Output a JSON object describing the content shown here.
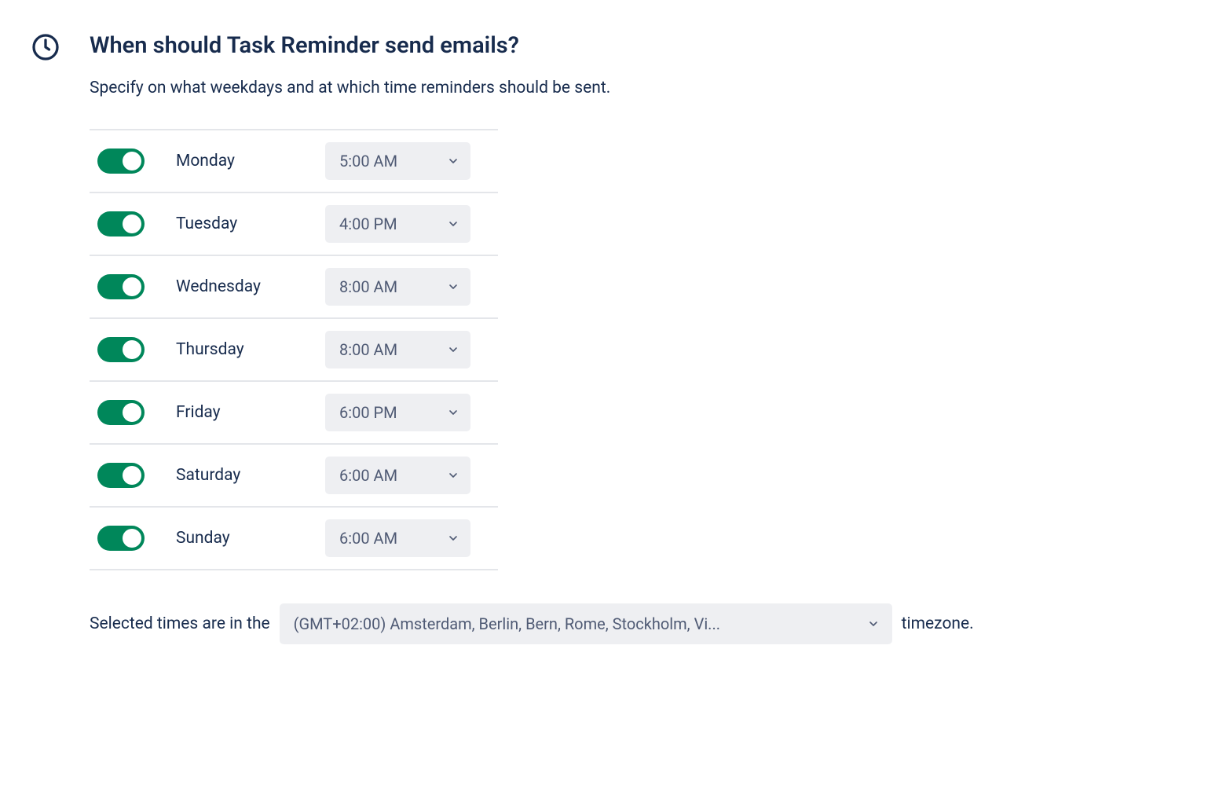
{
  "section": {
    "heading": "When should Task Reminder send emails?",
    "description": "Specify on what weekdays and at which time reminders should be sent."
  },
  "days": [
    {
      "label": "Monday",
      "enabled": true,
      "time": "5:00 AM"
    },
    {
      "label": "Tuesday",
      "enabled": true,
      "time": "4:00 PM"
    },
    {
      "label": "Wednesday",
      "enabled": true,
      "time": "8:00 AM"
    },
    {
      "label": "Thursday",
      "enabled": true,
      "time": "8:00 AM"
    },
    {
      "label": "Friday",
      "enabled": true,
      "time": "6:00 PM"
    },
    {
      "label": "Saturday",
      "enabled": true,
      "time": "6:00 AM"
    },
    {
      "label": "Sunday",
      "enabled": true,
      "time": "6:00 AM"
    }
  ],
  "timezone": {
    "prefix": "Selected times are in the",
    "value": "(GMT+02:00) Amsterdam, Berlin, Bern, Rome, Stockholm, Vi...",
    "suffix": "timezone."
  }
}
